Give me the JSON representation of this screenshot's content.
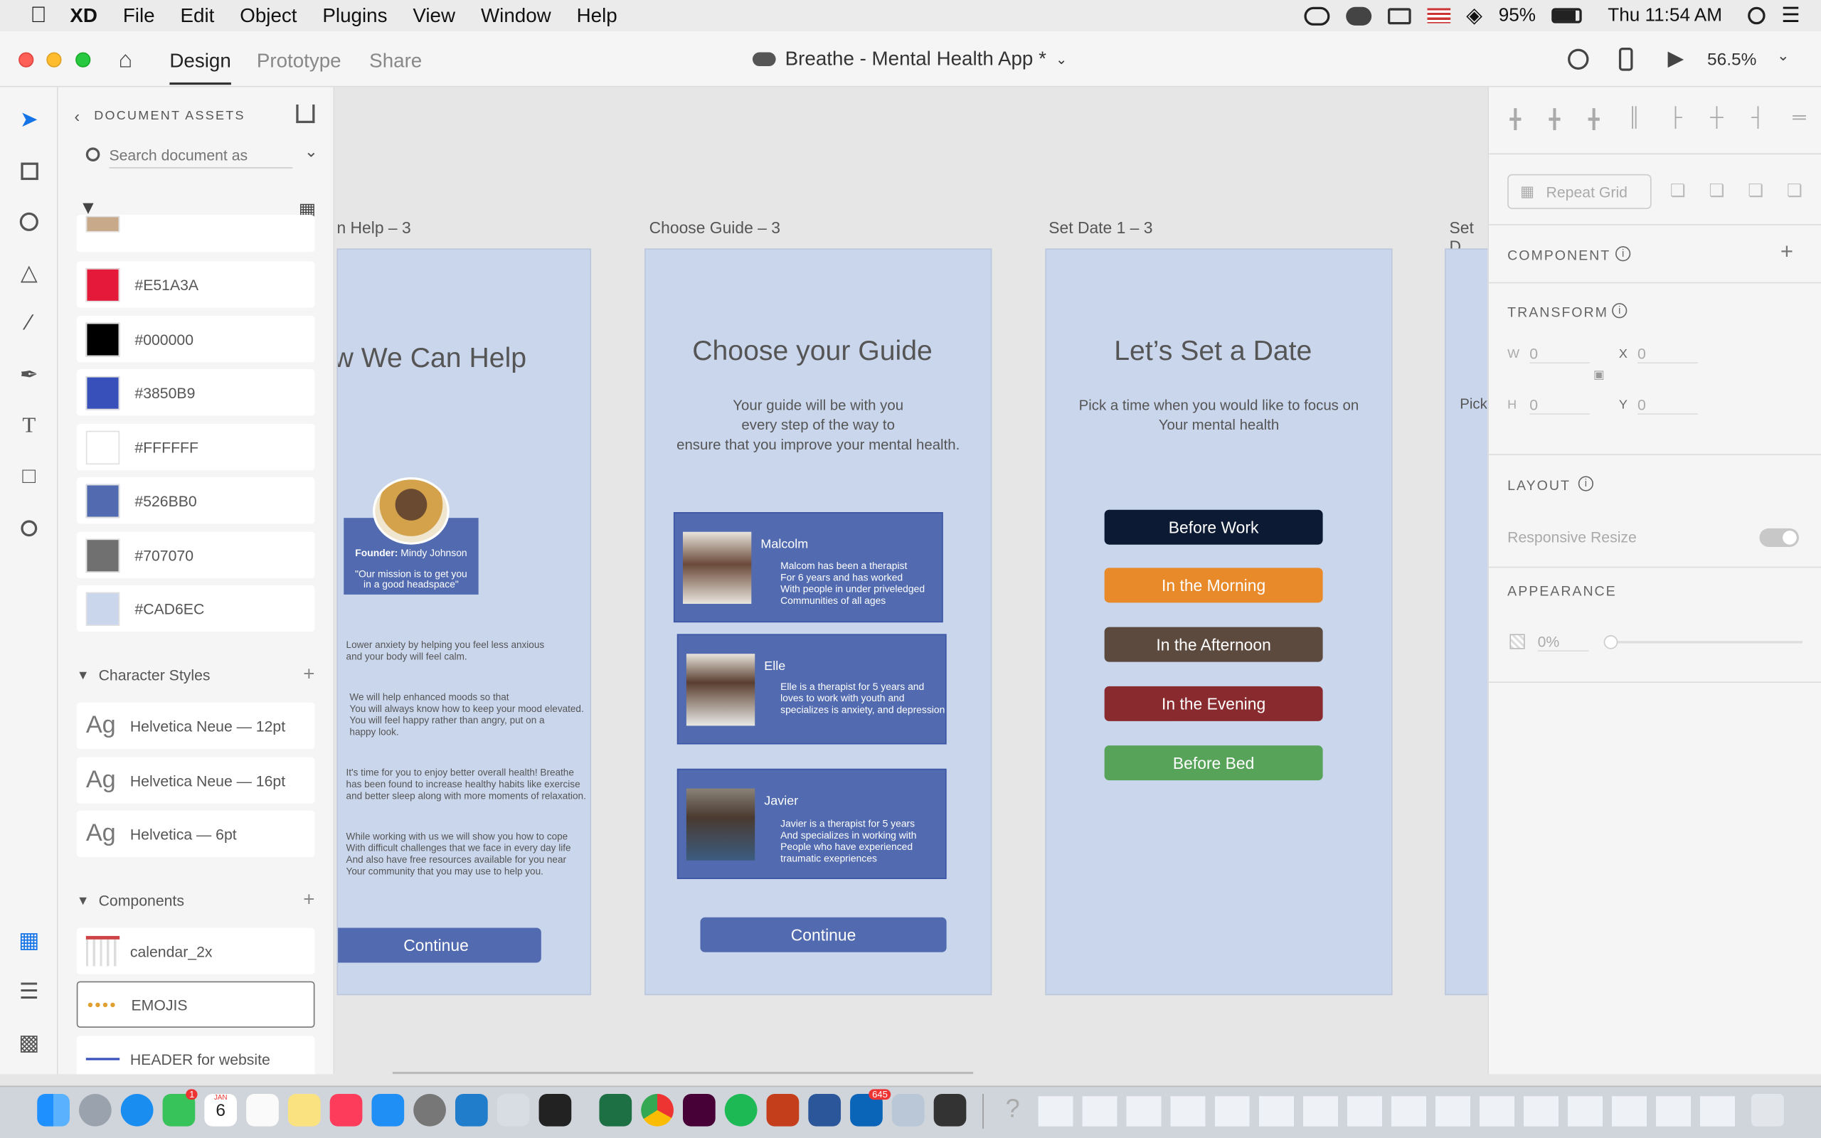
{
  "menubar": {
    "app": "XD",
    "items": [
      "File",
      "Edit",
      "Object",
      "Plugins",
      "View",
      "Window",
      "Help"
    ],
    "battery": "95%",
    "clock": "Thu 11:54 AM"
  },
  "titlebar": {
    "tabs": [
      "Design",
      "Prototype",
      "Share"
    ],
    "doc_title": "Breathe - Mental Health App *",
    "zoom": "56.5%"
  },
  "assets": {
    "header": "DOCUMENT ASSETS",
    "search_placeholder": "Search document as",
    "colors": [
      {
        "label": "#E51A3A",
        "hex": "#E51A3A"
      },
      {
        "label": "#000000",
        "hex": "#000000"
      },
      {
        "label": "#3850B9",
        "hex": "#3850B9"
      },
      {
        "label": "#FFFFFF",
        "hex": "#FFFFFF"
      },
      {
        "label": "#526BB0",
        "hex": "#526BB0"
      },
      {
        "label": "#707070",
        "hex": "#707070"
      },
      {
        "label": "#CAD6EC",
        "hex": "#CAD6EC"
      }
    ],
    "char_styles_title": "Character Styles",
    "char_styles": [
      {
        "ag": "Ag",
        "name": "Helvetica Neue — 12pt"
      },
      {
        "ag": "Ag",
        "name": "Helvetica Neue — 16pt"
      },
      {
        "ag": "Ag",
        "name": "Helvetica — 6pt"
      }
    ],
    "components_title": "Components",
    "components": [
      "calendar_2x",
      "EMOJIS",
      "HEADER for website"
    ]
  },
  "canvas": {
    "labels": [
      "n Help – 3",
      "Choose Guide – 3",
      "Set Date 1 – 3",
      "Set D"
    ],
    "help": {
      "title": "w We Can Help",
      "founder_label": "Founder:",
      "founder_name": "Mindy Johnson",
      "founder_quote": "\"Our mission is to get you\nin a good headspace\"",
      "p1": "Lower anxiety by helping you feel less anxious\nand your body will feel calm.",
      "p2": "We will help enhanced moods so that\nYou will always know how to keep your mood elevated.\nYou will feel happy rather than angry, put on a\nhappy look.",
      "p3": "It's time for you to enjoy better overall health! Breathe\nhas been found to increase healthy habits like exercise\nand better sleep along with more moments of relaxation.",
      "p4": "While working with us we will show you how to cope\nWith difficult challenges that we face in every day life\nAnd also have free resources available for you near\nYour community that you may use to help you.",
      "continue": "Continue"
    },
    "guide": {
      "title": "Choose your Guide",
      "subtitle": "Your guide will be with you\nevery step of the way to\nensure that you improve your mental health.",
      "guides": [
        {
          "name": "Malcolm",
          "desc": "Malcom has been a therapist\nFor 6 years and has worked\nWith people in under priveledged\nCommunities of all ages"
        },
        {
          "name": "Elle",
          "desc": "Elle is a therapist for 5 years and\nloves to work with youth and\nspecializes is anxiety, and depression"
        },
        {
          "name": "Javier",
          "desc": "Javier is a therapist for 5 years\nAnd specializes in working with\nPeople who have experienced\ntraumatic exepriences"
        }
      ],
      "continue": "Continue"
    },
    "date": {
      "title": "Let’s Set a Date",
      "subtitle": "Pick a time when you would like to focus on\nYour mental health",
      "options": [
        {
          "label": "Before Work",
          "color": "#0c1a33"
        },
        {
          "label": "In the Morning",
          "color": "#e8892a"
        },
        {
          "label": "In the Afternoon",
          "color": "#5c4a3e"
        },
        {
          "label": "In the Evening",
          "color": "#892a2e"
        },
        {
          "label": "Before Bed",
          "color": "#57a35a"
        }
      ]
    },
    "partial": {
      "text": "Pick"
    }
  },
  "props": {
    "repeat_grid": "Repeat Grid",
    "component": "COMPONENT",
    "transform": "TRANSFORM",
    "w_label": "W",
    "w_value": "0",
    "h_label": "H",
    "h_value": "0",
    "x_label": "X",
    "x_value": "0",
    "y_label": "Y",
    "y_value": "0",
    "layout": "LAYOUT",
    "responsive_resize": "Responsive Resize",
    "appearance": "APPEARANCE",
    "opacity": "0%"
  },
  "dock": {
    "calendar_day": "6",
    "calendar_month": "JAN",
    "outlook_badge": "645",
    "messages_badge": "1"
  }
}
